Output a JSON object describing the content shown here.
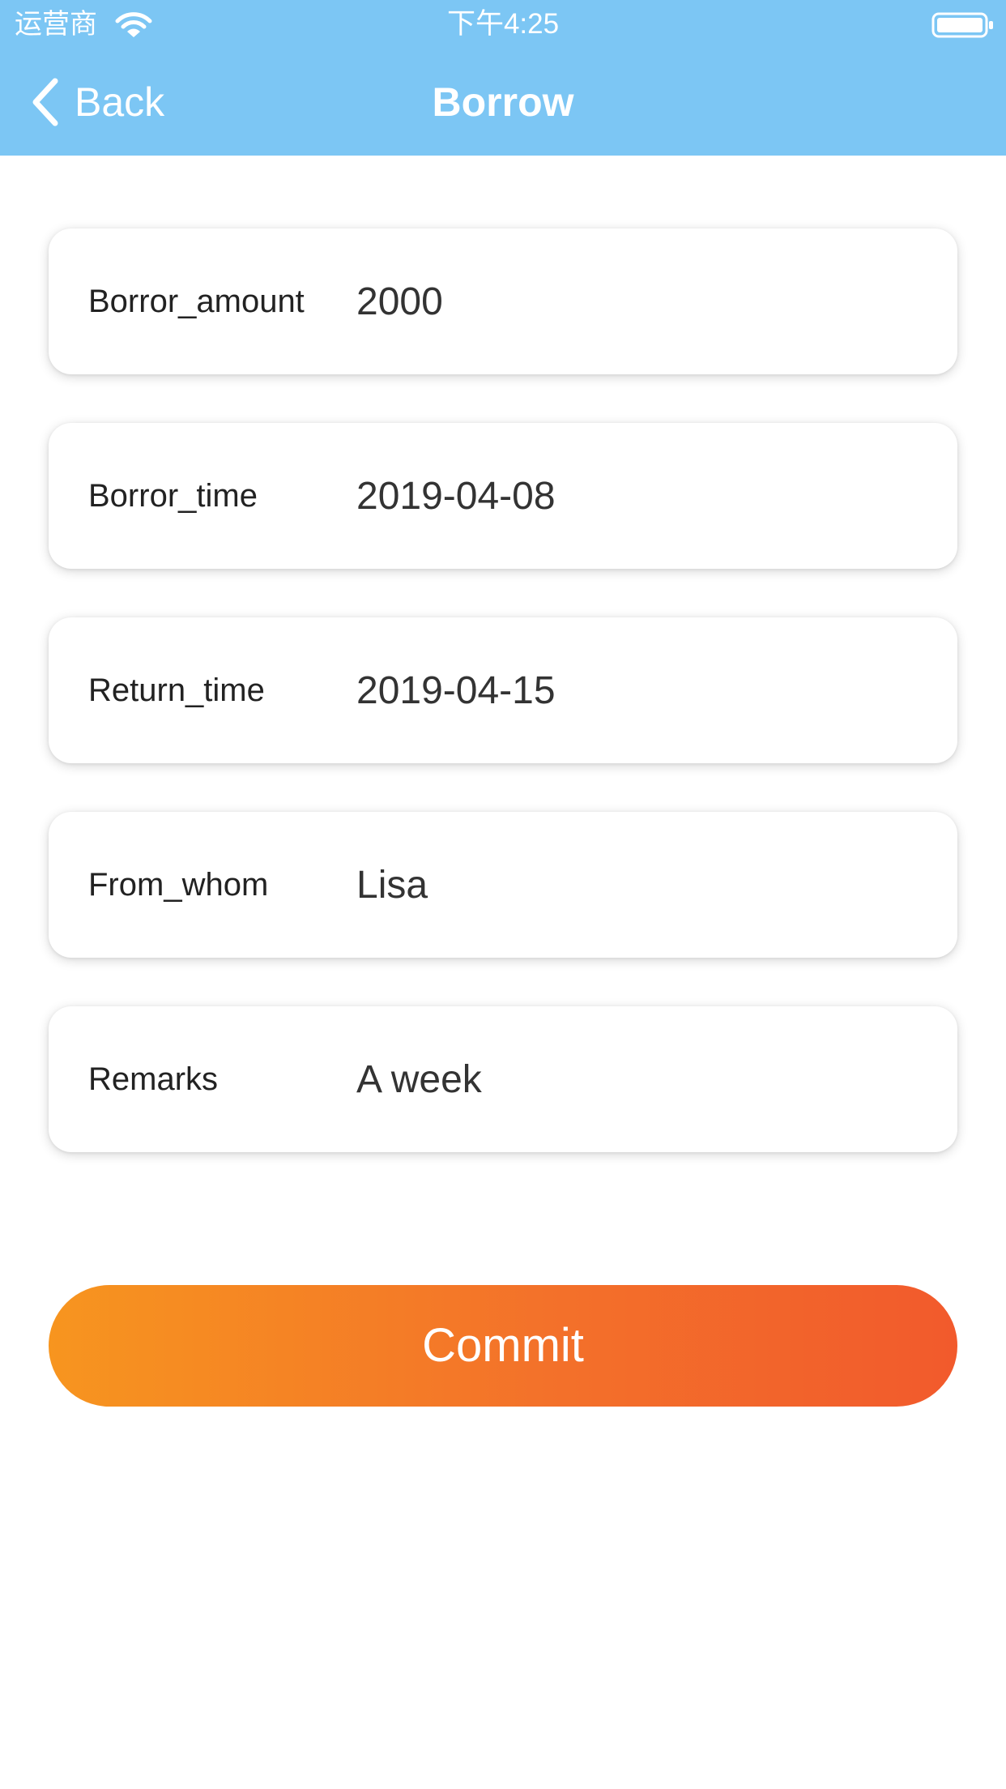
{
  "status_bar": {
    "carrier": "运营商",
    "time": "下午4:25",
    "wifi_icon": "wifi-icon",
    "battery_icon": "battery-icon"
  },
  "nav": {
    "back_label": "Back",
    "back_icon": "chevron-left-icon",
    "title": "Borrow"
  },
  "form": {
    "fields": [
      {
        "label": "Borror_amount",
        "value": "2000"
      },
      {
        "label": "Borror_time",
        "value": "2019-04-08"
      },
      {
        "label": "Return_time",
        "value": "2019-04-15"
      },
      {
        "label": "From_whom",
        "value": "Lisa"
      },
      {
        "label": "Remarks",
        "value": "A week"
      }
    ]
  },
  "actions": {
    "commit_label": "Commit"
  },
  "colors": {
    "header_background": "#7cc6f4",
    "button_gradient_start": "#f7951f",
    "button_gradient_end": "#f25a2c",
    "text_primary": "#222222"
  }
}
